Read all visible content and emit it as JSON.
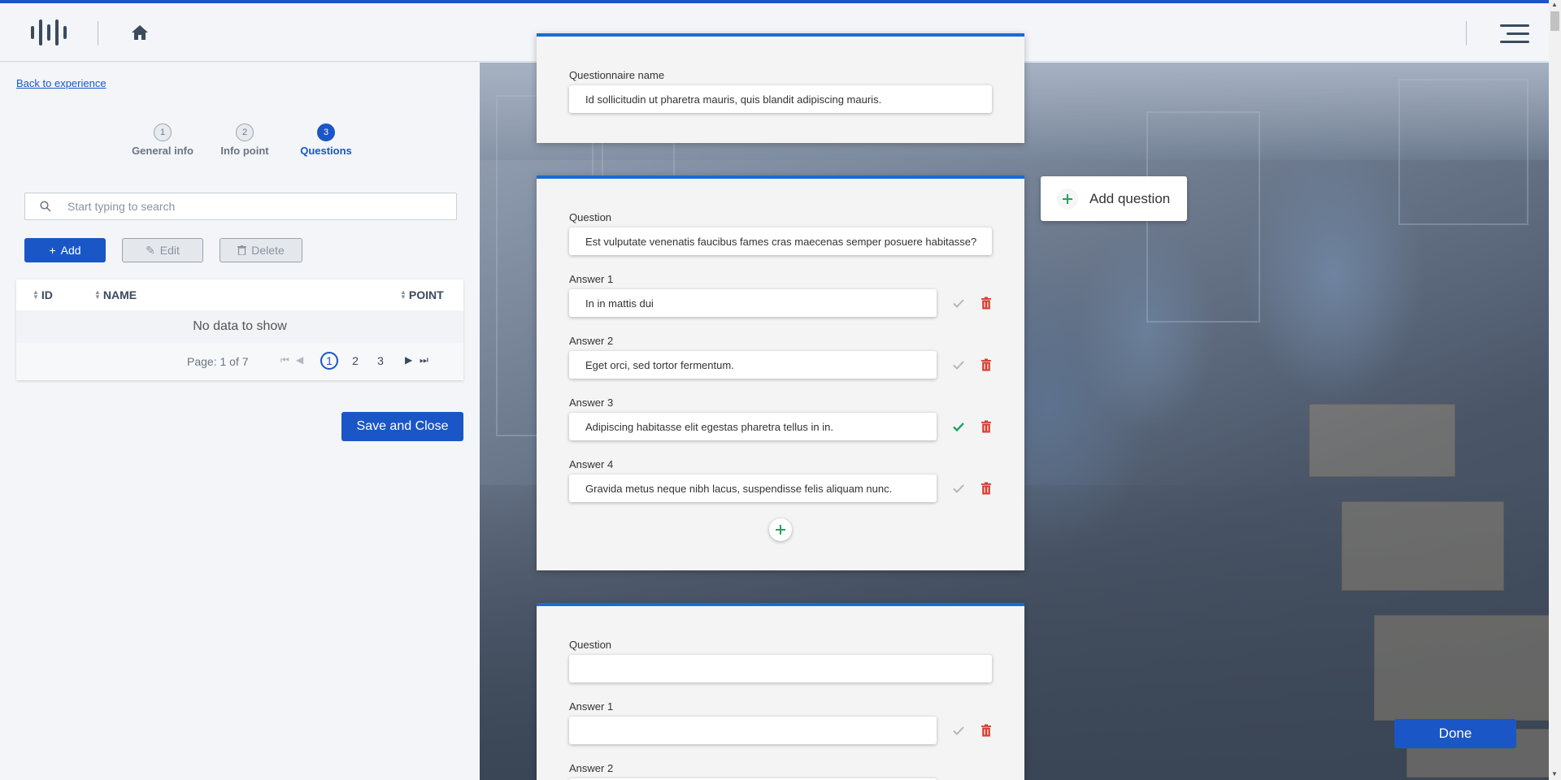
{
  "header": {
    "logo_name": "brand-logo",
    "home_icon": "home-icon",
    "menu_icon": "hamburger-menu-icon"
  },
  "left_panel": {
    "back_link": "Back to experience",
    "steps": [
      {
        "number": "1",
        "label": "General info",
        "active": false
      },
      {
        "number": "2",
        "label": "Info point",
        "active": false
      },
      {
        "number": "3",
        "label": "Questions",
        "active": true
      }
    ],
    "search": {
      "placeholder": "Start typing to search",
      "value": ""
    },
    "buttons": {
      "add": "Add",
      "edit": "Edit",
      "delete": "Delete"
    },
    "table": {
      "columns": [
        "ID",
        "NAME",
        "POINT"
      ],
      "empty_text": "No data to show",
      "page_info": "Page: 1 of 7",
      "pages": [
        "1",
        "2",
        "3"
      ],
      "current_page": "1"
    },
    "save_close": "Save and Close"
  },
  "questionnaire": {
    "name_label": "Questionnaire name",
    "name_value": "Id sollicitudin ut pharetra mauris, quis blandit adipiscing mauris."
  },
  "questions": [
    {
      "question_label": "Question",
      "question_value": "Est vulputate venenatis faucibus fames cras maecenas semper posuere habitasse?",
      "answers": [
        {
          "label": "Answer 1",
          "value": "In in mattis dui",
          "correct": false
        },
        {
          "label": "Answer 2",
          "value": "Eget orci, sed tortor fermentum.",
          "correct": false
        },
        {
          "label": "Answer 3",
          "value": "Adipiscing habitasse elit egestas pharetra tellus in in.",
          "correct": true
        },
        {
          "label": "Answer 4",
          "value": "Gravida metus neque nibh lacus, suspendisse felis aliquam nunc.",
          "correct": false
        }
      ]
    },
    {
      "question_label": "Question",
      "question_value": "",
      "answers": [
        {
          "label": "Answer 1",
          "value": "",
          "correct": false
        },
        {
          "label": "Answer 2",
          "value": "",
          "correct": false
        }
      ]
    }
  ],
  "add_question": "Add question",
  "done": "Done",
  "colors": {
    "primary": "#1a56c6",
    "card_accent": "#1a6ad6",
    "correct_green": "#1fa463",
    "delete_red": "#d63b2f",
    "muted_check": "#b5b5b5"
  }
}
